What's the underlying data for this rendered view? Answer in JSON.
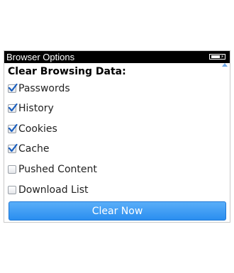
{
  "window": {
    "title": "Browser Options"
  },
  "section": {
    "heading": "Clear Browsing Data:"
  },
  "options": [
    {
      "label": "Passwords",
      "checked": true
    },
    {
      "label": "History",
      "checked": true
    },
    {
      "label": "Cookies",
      "checked": true
    },
    {
      "label": "Cache",
      "checked": true
    },
    {
      "label": "Pushed Content",
      "checked": false
    },
    {
      "label": "Download List",
      "checked": false
    }
  ],
  "action": {
    "label": "Clear Now"
  },
  "colors": {
    "titlebar": "#000000",
    "button": "#3a9bf4",
    "check": "#1a5fbf"
  }
}
